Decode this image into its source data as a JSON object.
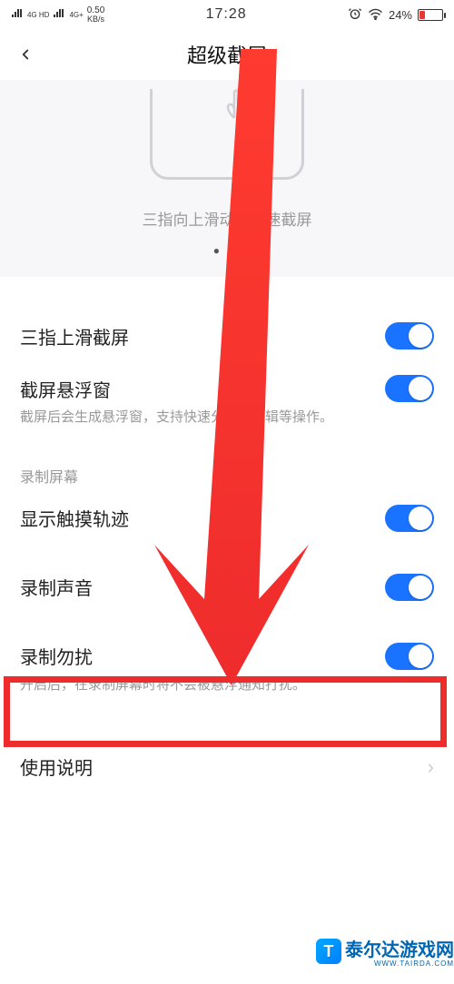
{
  "status": {
    "signal1": "4G HD",
    "signal2": "4G+",
    "speed_num": "0.50",
    "speed_unit": "KB/s",
    "time": "17:28",
    "battery_pct": "24%"
  },
  "nav": {
    "title": "超级截屏"
  },
  "demo": {
    "caption": "三指向上滑动可快速截屏"
  },
  "settings": {
    "item1": {
      "label": "三指上滑截屏"
    },
    "item2": {
      "label": "截屏悬浮窗",
      "desc": "截屏后会生成悬浮窗，支持快速分享、编辑等操作。"
    },
    "section_label": "录制屏幕",
    "item3": {
      "label": "显示触摸轨迹"
    },
    "item4": {
      "label": "录制声音"
    },
    "item5": {
      "label": "录制勿扰",
      "desc": "开启后，在录制屏幕时将不会被悬浮通知打扰。"
    },
    "item6": {
      "label": "使用说明"
    }
  },
  "watermark": {
    "badge": "T",
    "text": "泰尔达游戏网",
    "sub": "WWW.TAIRDA.COM"
  }
}
